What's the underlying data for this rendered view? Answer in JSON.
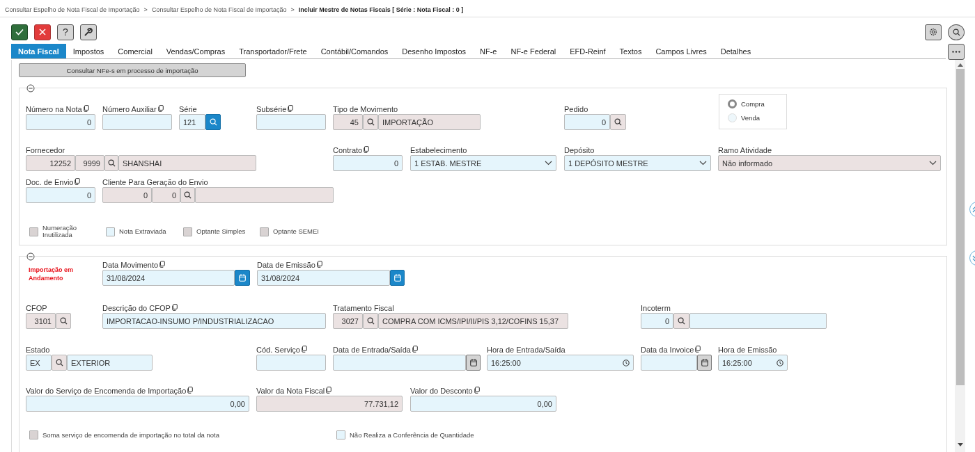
{
  "breadcrumb": {
    "separator": ">",
    "items": [
      {
        "text": "Consultar Espelho de Nota Fiscal de Importação",
        "current": false
      },
      {
        "text": "Consultar Espelho de Nota Fiscal de Importação",
        "current": false
      },
      {
        "text": "Incluir Mestre de Notas Fiscais [ Série : Nota Fiscal : 0 ]",
        "current": true
      }
    ]
  },
  "toolbar": {
    "buttons": [
      {
        "kind": "confirm"
      },
      {
        "kind": "cancel"
      },
      {
        "kind": "help",
        "text": "?"
      },
      {
        "kind": "tools"
      }
    ],
    "right_buttons": [
      {
        "kind": "settings"
      },
      {
        "kind": "search"
      }
    ]
  },
  "tabs": [
    {
      "label": "Nota Fiscal",
      "selected": true
    },
    {
      "label": "Impostos",
      "selected": false
    },
    {
      "label": "Comercial",
      "selected": false
    },
    {
      "label": "Vendas/Compras",
      "selected": false
    },
    {
      "label": "Transportador/Frete",
      "selected": false
    },
    {
      "label": "Contábil/Comandos",
      "selected": false
    },
    {
      "label": "Desenho Impostos",
      "selected": false
    },
    {
      "label": "NF-e",
      "selected": false
    },
    {
      "label": "NF-e Federal",
      "selected": false
    },
    {
      "label": "EFD-Reinf",
      "selected": false
    },
    {
      "label": "Textos",
      "selected": false
    },
    {
      "label": "Campos Livres",
      "selected": false
    },
    {
      "label": "Detalhes",
      "selected": false
    }
  ],
  "consult_button": "Consultar NFe-s em processo de importação",
  "panels": [
    {
      "expanded": true,
      "rows": [
        {
          "fields": [
            {
              "kind": "field",
              "label": "Número na Nota",
              "copy_icon": true,
              "parts": [
                {
                  "kind": "number",
                  "value": "0",
                  "readonly": false
                }
              ]
            },
            {
              "kind": "field",
              "label": "Número Auxiliar",
              "copy_icon": true,
              "parts": [
                {
                  "kind": "text",
                  "readonly": false
                }
              ]
            },
            {
              "kind": "field",
              "label": "Série",
              "copy_icon": false,
              "parts": [
                {
                  "kind": "text",
                  "value": "121",
                  "readonly": false
                },
                {
                  "kind": "search",
                  "highlighted": true
                }
              ]
            },
            {
              "kind": "field",
              "label": "Subsérie",
              "copy_icon": true,
              "parts": [
                {
                  "kind": "text",
                  "readonly": false
                }
              ]
            },
            {
              "kind": "field",
              "label": "Tipo de Movimento",
              "copy_icon": false,
              "parts": [
                {
                  "kind": "number",
                  "value": "45",
                  "readonly": true
                },
                {
                  "kind": "search",
                  "highlighted": false
                },
                {
                  "kind": "text",
                  "value": "IMPORTAÇÃO",
                  "readonly": true
                }
              ]
            },
            {
              "kind": "field",
              "label": "Pedido",
              "copy_icon": false,
              "parts": [
                {
                  "kind": "number",
                  "value": "0",
                  "readonly": false
                },
                {
                  "kind": "search",
                  "highlighted": false
                }
              ]
            }
          ]
        },
        {
          "fields": [
            {
              "kind": "field",
              "label": "Fornecedor",
              "copy_icon": false,
              "parts": [
                {
                  "kind": "number",
                  "value": "12252",
                  "readonly": true
                },
                {
                  "kind": "number",
                  "value": "9999",
                  "readonly": true
                },
                {
                  "kind": "search",
                  "highlighted": false
                },
                {
                  "kind": "text",
                  "value": "SHANSHAI",
                  "readonly": true
                }
              ]
            },
            {
              "kind": "field",
              "label": "Contrato",
              "copy_icon": true,
              "parts": [
                {
                  "kind": "number",
                  "value": "0",
                  "readonly": false
                }
              ]
            },
            {
              "kind": "field",
              "label": "Estabelecimento",
              "copy_icon": false,
              "parts": [
                {
                  "kind": "select",
                  "value": "1 ESTAB. MESTRE",
                  "readonly": false
                }
              ]
            },
            {
              "kind": "field",
              "label": "Depósito",
              "copy_icon": false,
              "parts": [
                {
                  "kind": "select",
                  "value": "1 DEPÓSITO MESTRE",
                  "readonly": false
                }
              ]
            },
            {
              "kind": "field",
              "label": "Ramo Atividade",
              "copy_icon": false,
              "parts": [
                {
                  "kind": "select",
                  "value": "Não informado",
                  "readonly": true
                }
              ]
            }
          ]
        },
        {
          "fields": [
            {
              "kind": "field",
              "label": "Doc. de Envio",
              "copy_icon": true,
              "parts": [
                {
                  "kind": "number",
                  "value": "0",
                  "readonly": false
                }
              ]
            },
            {
              "kind": "field",
              "label": "Cliente Para Geração do Envio",
              "copy_icon": false,
              "parts": [
                {
                  "kind": "number",
                  "value": "0",
                  "readonly": true
                },
                {
                  "kind": "number",
                  "value": "0",
                  "readonly": true
                },
                {
                  "kind": "search",
                  "highlighted": false
                },
                {
                  "kind": "text",
                  "readonly": true
                }
              ]
            }
          ]
        }
      ],
      "radio_group": {
        "options": [
          {
            "label": "Compra",
            "selected": true
          },
          {
            "label": "Venda",
            "selected": false
          }
        ]
      },
      "checkboxes": [
        {
          "label": "Numeração Inutilizada",
          "disabled": true
        },
        {
          "label": "Nota Extraviada",
          "disabled": false
        },
        {
          "label": "Optante Simples",
          "disabled": true
        },
        {
          "label": "Optante SEMEI",
          "disabled": true
        }
      ]
    },
    {
      "expanded": true,
      "rows": [
        {
          "fields": [
            {
              "kind": "status",
              "text": "Importação em Andamento"
            },
            {
              "kind": "field",
              "label": "Data Movimento",
              "copy_icon": true,
              "parts": [
                {
                  "kind": "text",
                  "value": "31/08/2024",
                  "readonly": false
                },
                {
                  "kind": "calendar",
                  "highlighted": true
                }
              ]
            },
            {
              "kind": "field",
              "label": "Data de Emissão",
              "copy_icon": true,
              "parts": [
                {
                  "kind": "text",
                  "value": "31/08/2024",
                  "readonly": false
                },
                {
                  "kind": "calendar",
                  "highlighted": true
                }
              ]
            }
          ]
        },
        {
          "fields": [
            {
              "kind": "field",
              "label": "CFOP",
              "copy_icon": false,
              "parts": [
                {
                  "kind": "number",
                  "value": "3101",
                  "readonly": true
                },
                {
                  "kind": "search",
                  "highlighted": false
                }
              ]
            },
            {
              "kind": "field",
              "label": "Descrição do CFOP",
              "copy_icon": true,
              "parts": [
                {
                  "kind": "text",
                  "value": "IMPORTACAO-INSUMO P/INDUSTRIALIZACAO",
                  "readonly": false
                }
              ]
            },
            {
              "kind": "field",
              "label": "Tratamento Fiscal",
              "copy_icon": false,
              "parts": [
                {
                  "kind": "number",
                  "value": "3027",
                  "readonly": true
                },
                {
                  "kind": "search",
                  "highlighted": false
                },
                {
                  "kind": "text",
                  "value": "COMPRA COM ICMS/IPI/II/PIS 3,12/COFINS 15,37",
                  "readonly": true
                }
              ]
            },
            {
              "kind": "field",
              "label": "Incoterm",
              "copy_icon": false,
              "parts": [
                {
                  "kind": "number",
                  "value": "0",
                  "readonly": false
                },
                {
                  "kind": "search",
                  "highlighted": false
                },
                {
                  "kind": "text",
                  "readonly": false
                }
              ]
            }
          ]
        },
        {
          "fields": [
            {
              "kind": "field",
              "label": "Estado",
              "copy_icon": false,
              "parts": [
                {
                  "kind": "text",
                  "value": "EX",
                  "readonly": false
                },
                {
                  "kind": "search",
                  "highlighted": false
                },
                {
                  "kind": "text",
                  "value": "EXTERIOR",
                  "readonly": false
                }
              ]
            },
            {
              "kind": "field",
              "label": "Cód. Serviço",
              "copy_icon": true,
              "parts": [
                {
                  "kind": "text",
                  "readonly": false
                }
              ]
            },
            {
              "kind": "field",
              "label": "Data de Entrada/Saída",
              "copy_icon": true,
              "parts": [
                {
                  "kind": "text",
                  "readonly": false
                },
                {
                  "kind": "calendar",
                  "highlighted": false
                }
              ]
            },
            {
              "kind": "field",
              "label": "Hora de Entrada/Saída",
              "copy_icon": false,
              "parts": [
                {
                  "kind": "time",
                  "value": "16:25:00",
                  "readonly": false
                }
              ]
            },
            {
              "kind": "field",
              "label": "Data da Invoice",
              "copy_icon": true,
              "parts": [
                {
                  "kind": "text",
                  "readonly": false
                },
                {
                  "kind": "calendar",
                  "highlighted": false
                }
              ]
            },
            {
              "kind": "field",
              "label": "Hora de Emissão",
              "copy_icon": false,
              "parts": [
                {
                  "kind": "time",
                  "value": "16:25:00",
                  "readonly": false
                }
              ]
            }
          ]
        },
        {
          "fields": [
            {
              "kind": "field",
              "label": "Valor do Serviço de Encomenda de Importação",
              "copy_icon": true,
              "parts": [
                {
                  "kind": "number",
                  "value": "0,00",
                  "readonly": false
                }
              ]
            },
            {
              "kind": "field",
              "label": "Valor da Nota Fiscal",
              "copy_icon": true,
              "parts": [
                {
                  "kind": "number",
                  "value": "77.731,12",
                  "readonly": true
                }
              ]
            },
            {
              "kind": "field",
              "label": "Valor do Desconto",
              "copy_icon": true,
              "parts": [
                {
                  "kind": "number",
                  "value": "0,00",
                  "readonly": false
                }
              ]
            }
          ]
        }
      ],
      "checkboxes": [
        {
          "label": "Soma serviço de encomenda de importação no total da nota",
          "disabled": true
        },
        {
          "label": "Não Realiza a Conferência de Quantidade",
          "disabled": false
        }
      ]
    }
  ]
}
